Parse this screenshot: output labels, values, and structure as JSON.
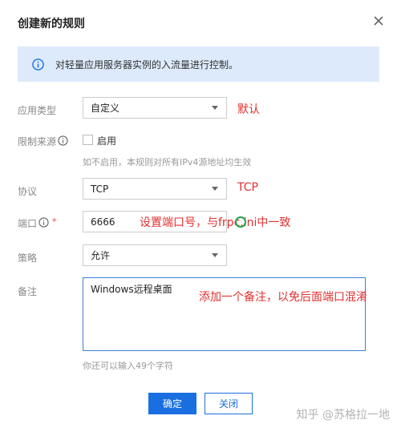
{
  "dialog": {
    "title": "创建新的规则",
    "info_text": "对轻量应用服务器实例的入流量进行控制。"
  },
  "form": {
    "app_type": {
      "label": "应用类型",
      "value": "自定义"
    },
    "source_limit": {
      "label": "限制来源",
      "checkbox_label": "启用",
      "hint": "如不启用，本规则对所有IPv4源地址均生效",
      "checked": false
    },
    "protocol": {
      "label": "协议",
      "value": "TCP"
    },
    "port": {
      "label": "端口",
      "required_mark": "*",
      "value": "6666"
    },
    "policy": {
      "label": "策略",
      "value": "允许"
    },
    "remark": {
      "label": "备注",
      "value": "Windows远程桌面",
      "hint": "你还可以输入49个字符"
    }
  },
  "annotations": {
    "app_type": "默认",
    "protocol": "TCP",
    "port": "设置端口号，与frpc.ini中一致",
    "remark": "添加一个备注，以免后面端口混淆"
  },
  "buttons": {
    "confirm": "确定",
    "close": "关闭"
  },
  "watermark": "知乎 @苏格拉一地",
  "colors": {
    "primary": "#1a6fe0",
    "info_bg": "#dceafb",
    "annotation": "#e03030"
  }
}
